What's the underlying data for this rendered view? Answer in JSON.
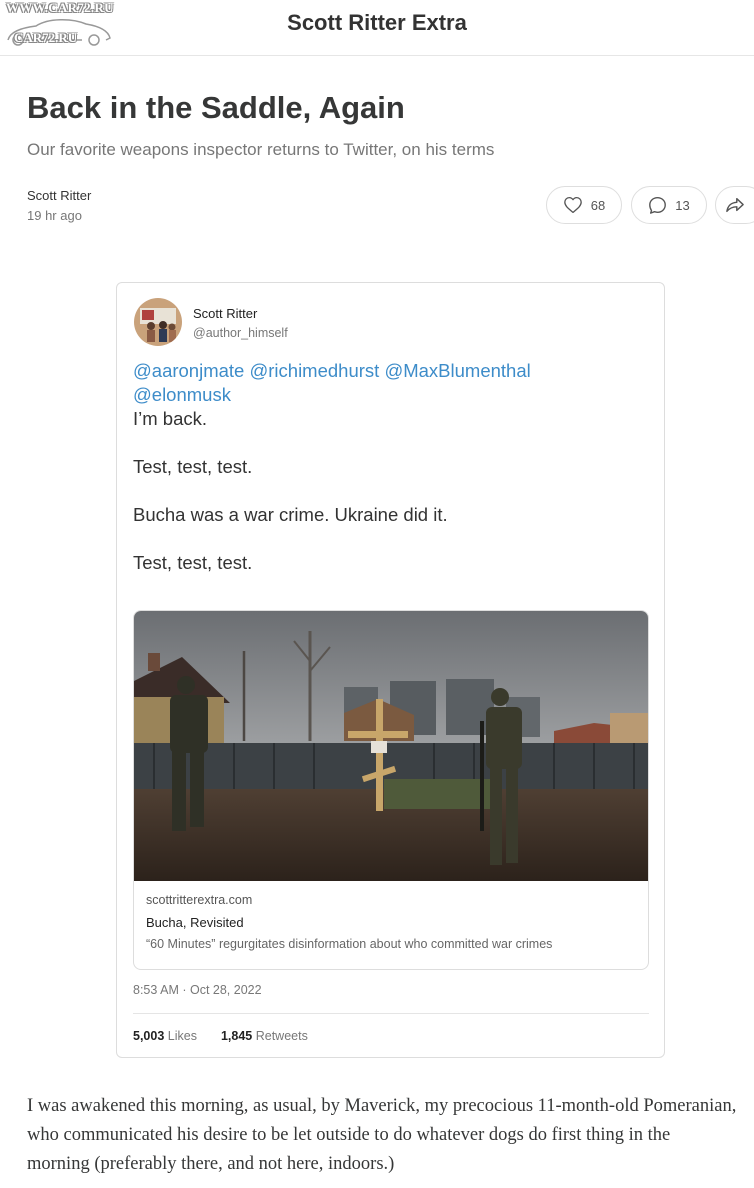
{
  "watermark": {
    "top": "WWW.CAR72.RU",
    "bottom": "CAR72.RU"
  },
  "header": {
    "site_title": "Scott Ritter Extra"
  },
  "post": {
    "title": "Back in the Saddle, Again",
    "subtitle": "Our favorite weapons inspector returns to Twitter, on his terms",
    "author": "Scott Ritter",
    "date": "19 hr ago",
    "likes": "68",
    "comments": "13"
  },
  "tweet": {
    "name": "Scott Ritter",
    "handle": "@author_himself",
    "mentions": [
      "@aaronjmate",
      "@richimedhurst",
      "@MaxBlumenthal",
      "@elonmusk"
    ],
    "lines": [
      "I’m back.",
      "Test, test, test.",
      "Bucha was a war crime. Ukraine did it.",
      "Test, test, test."
    ],
    "link": {
      "domain": "scottritterextra.com",
      "title": "Bucha, Revisited",
      "description": "“60 Minutes” regurgitates disinformation about who committed war crimes"
    },
    "timestamp": "8:53 AM · Oct 28, 2022",
    "likes_count": "5,003",
    "likes_label": "Likes",
    "retweets_count": "1,845",
    "retweets_label": "Retweets"
  },
  "body": {
    "paragraph": "I was awakened this morning, as usual, by Maverick, my precocious 11-month-old Pomeranian, who communicated his desire to be let outside to do whatever dogs do first thing in the morning (preferably there, and not here, indoors.)"
  },
  "colors": {
    "link": "#3d8cc9",
    "border": "#dddddd",
    "text": "#363737"
  },
  "icons": [
    "heart-icon",
    "comment-icon",
    "share-icon"
  ]
}
